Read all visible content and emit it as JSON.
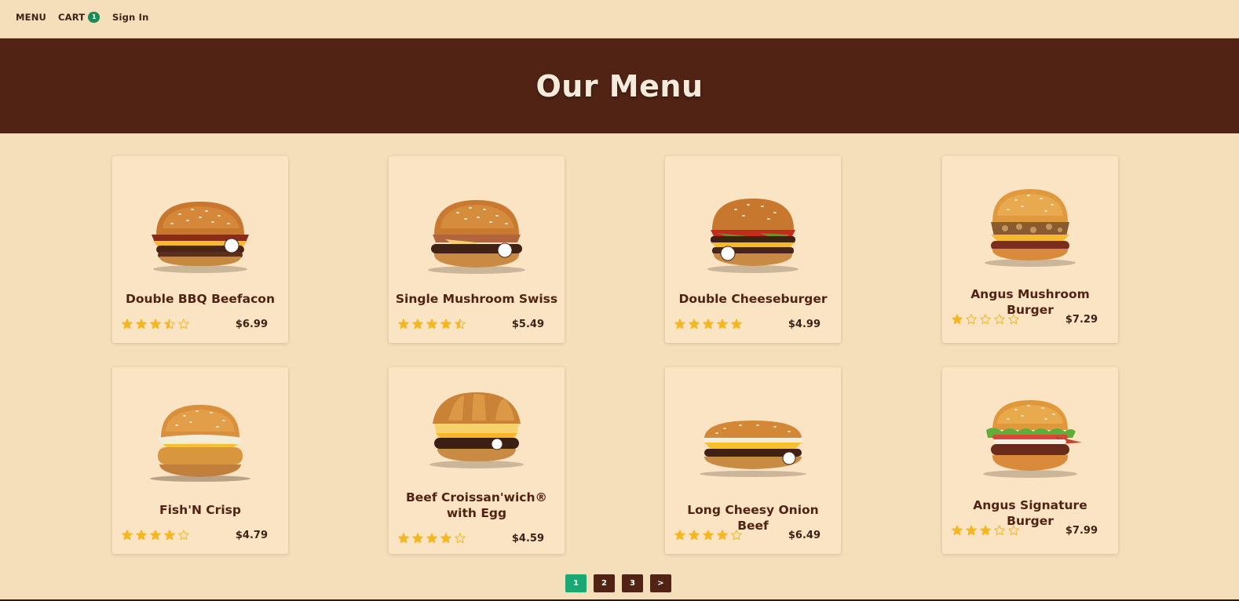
{
  "nav": {
    "menu_label": "MENU",
    "cart_label": "CART",
    "cart_count": "1",
    "signin_label": "Sign In"
  },
  "hero": {
    "title": "Our Menu"
  },
  "colors": {
    "brand_brown": "#502314",
    "background": "#f5deba",
    "card_bg": "#fbe4c4",
    "star_gold": "#f5b623",
    "active_page": "#1aa874",
    "cart_badge": "#1a8a56"
  },
  "products": [
    {
      "name": "Double BBQ Beefacon",
      "price": "$6.99",
      "rating": 3.5,
      "icon": "burger-image"
    },
    {
      "name": "Single Mushroom Swiss",
      "price": "$5.49",
      "rating": 4.5,
      "icon": "burger-image"
    },
    {
      "name": "Double Cheeseburger",
      "price": "$4.99",
      "rating": 5,
      "icon": "burger-image"
    },
    {
      "name": "Angus Mushroom Burger",
      "price": "$7.29",
      "rating": 1,
      "icon": "burger-image"
    },
    {
      "name": "Fish'N Crisp",
      "price": "$4.79",
      "rating": 4,
      "icon": "fish-sandwich-image"
    },
    {
      "name": "Beef Croissan'wich® with Egg",
      "price": "$4.59",
      "rating": 4,
      "icon": "croissant-sandwich-image"
    },
    {
      "name": "Long Cheesy Onion Beef",
      "price": "$6.49",
      "rating": 4,
      "icon": "long-sandwich-image"
    },
    {
      "name": "Angus Signature Burger",
      "price": "$7.99",
      "rating": 3,
      "icon": "burger-image"
    }
  ],
  "pagination": {
    "pages": [
      "1",
      "2",
      "3"
    ],
    "active": "1",
    "next_label": ">"
  }
}
